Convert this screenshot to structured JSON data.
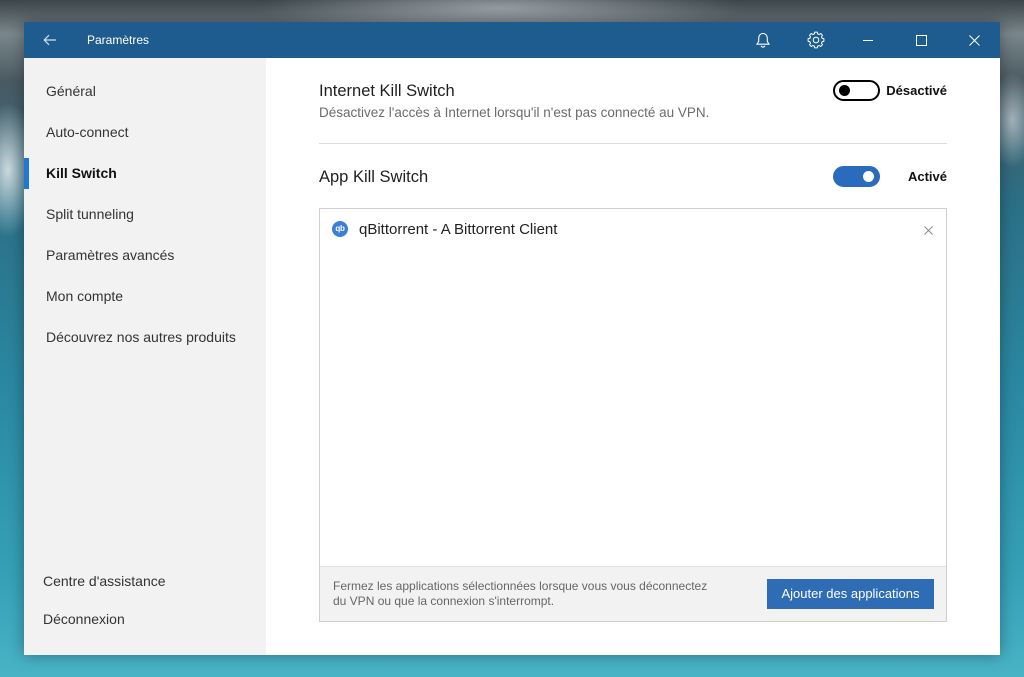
{
  "window": {
    "title": "Paramètres"
  },
  "colors": {
    "titlebar": "#1e5c8f",
    "accent": "#1f78d1",
    "toggle_on": "#2b6bbd",
    "button": "#2e6cb5",
    "app_icon": "#3d7fd5"
  },
  "titlebar_icons": [
    "back-arrow-icon",
    "bell-icon",
    "gear-icon",
    "minimize-icon",
    "maximize-icon",
    "close-icon"
  ],
  "sidebar": {
    "items": [
      {
        "label": "Général",
        "active": false
      },
      {
        "label": "Auto-connect",
        "active": false
      },
      {
        "label": "Kill Switch",
        "active": true
      },
      {
        "label": "Split tunneling",
        "active": false
      },
      {
        "label": "Paramètres avancés",
        "active": false
      },
      {
        "label": "Mon compte",
        "active": false
      },
      {
        "label": "Découvrez nos autres produits",
        "active": false
      }
    ],
    "footer": [
      {
        "label": "Centre d'assistance"
      },
      {
        "label": "Déconnexion"
      }
    ]
  },
  "internet_kill_switch": {
    "title": "Internet Kill Switch",
    "description": "Désactivez l'accès à Internet lorsqu'il n'est pas connecté au VPN.",
    "enabled": false,
    "state_label": "Désactivé"
  },
  "app_kill_switch": {
    "title": "App Kill Switch",
    "enabled": true,
    "state_label": "Activé",
    "apps": [
      {
        "name": "qBittorrent - A Bittorrent Client",
        "icon": "qbittorrent-icon",
        "icon_label": "qb"
      }
    ],
    "footer_note": [
      "Fermez les applications sélectionnées lorsque vous vous déconnectez",
      "du VPN ou que la connexion s'interrompt."
    ],
    "add_button_label": "Ajouter des applications"
  }
}
